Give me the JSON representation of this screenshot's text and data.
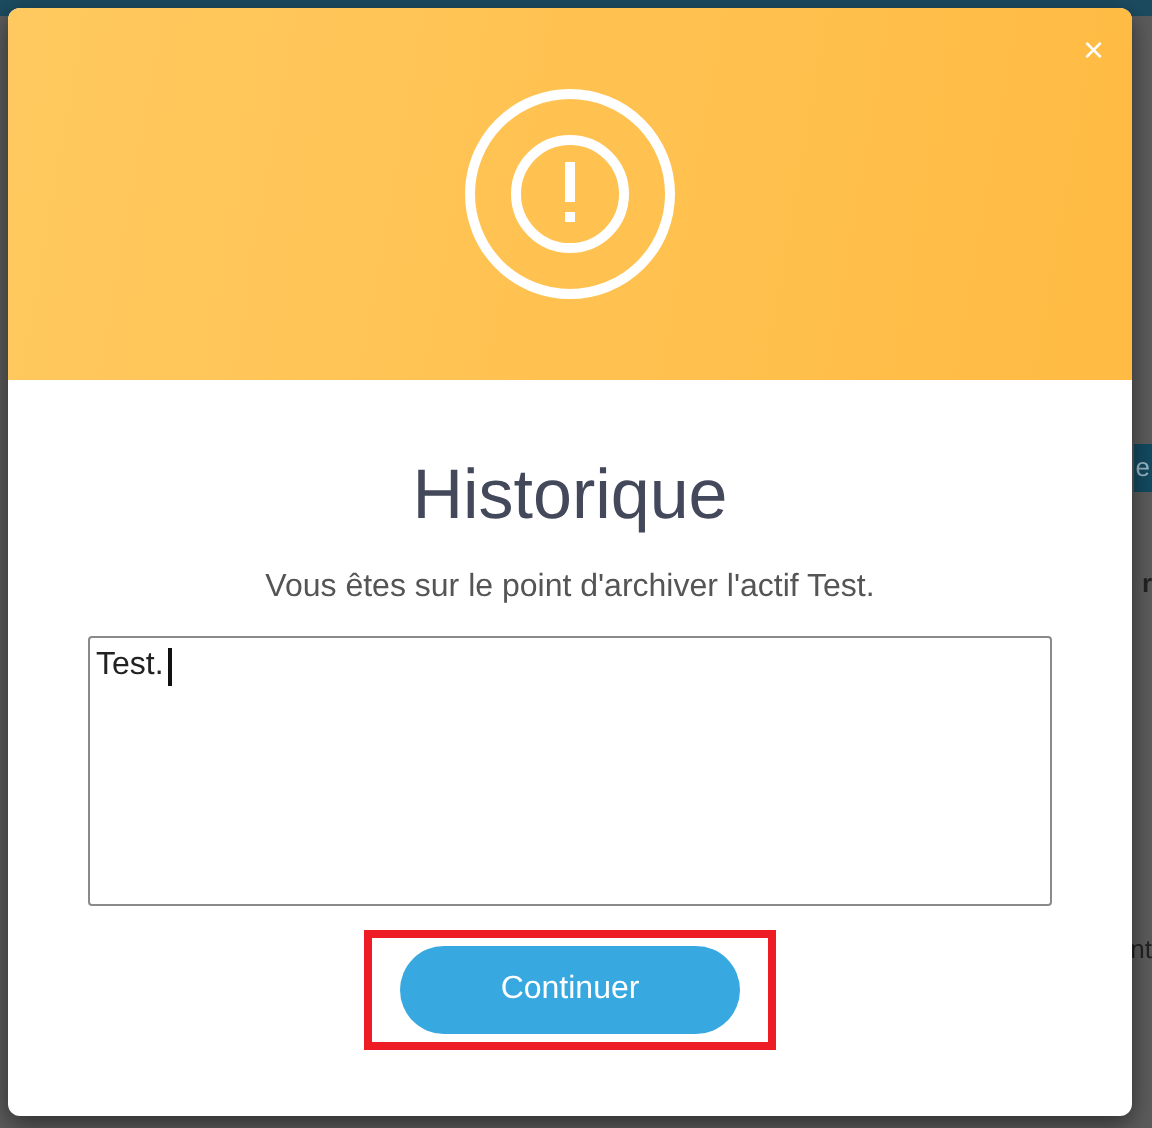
{
  "background": {
    "fragments": [
      {
        "text": "e",
        "kind": "button"
      },
      {
        "text": "r",
        "kind": "heading"
      },
      {
        "text": "nt",
        "kind": "text"
      }
    ]
  },
  "dialog": {
    "title": "Historique",
    "message": "Vous êtes sur le point d'archiver l'actif Test.",
    "field_value": "Test.",
    "button": "Continuer",
    "button_highlighted": true,
    "close": "×"
  }
}
